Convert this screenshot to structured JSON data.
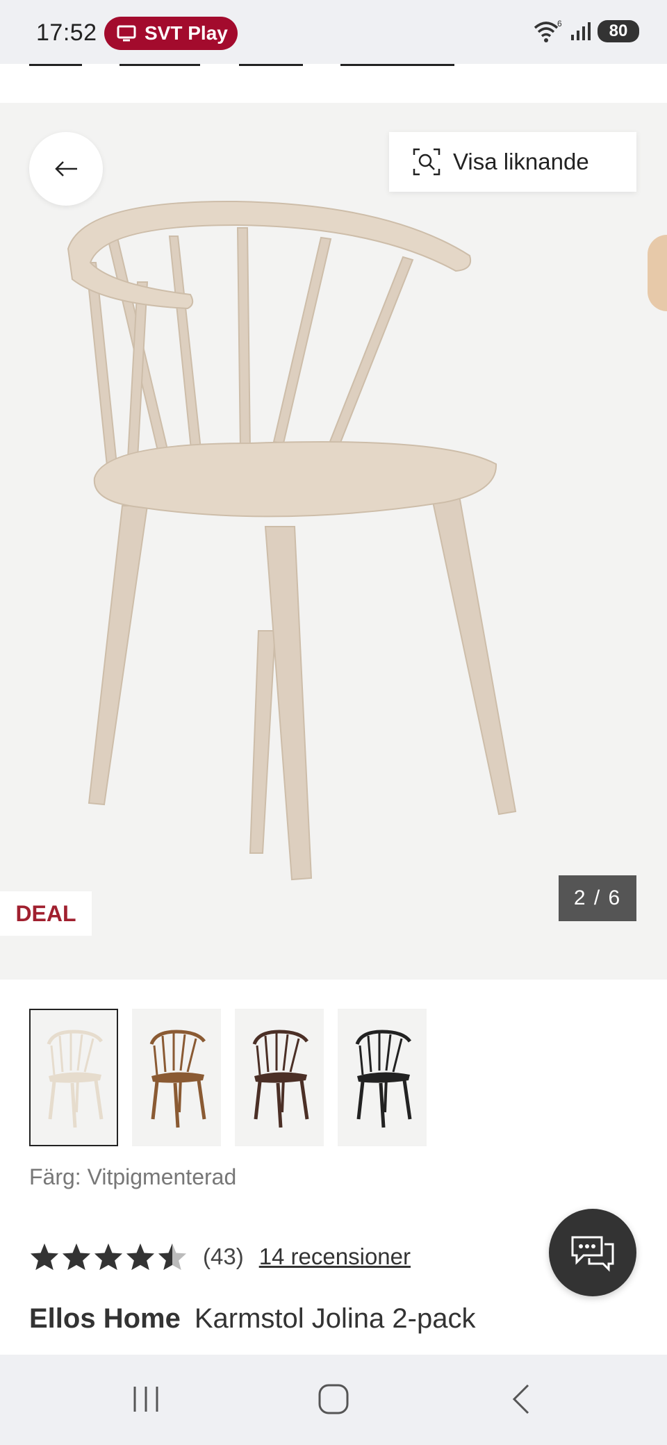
{
  "status_bar": {
    "time": "17:52",
    "notification_pill": "SVT Play",
    "pill_color": "#a30b2d",
    "battery": "80",
    "wifi_badge": "6"
  },
  "hero": {
    "similar_button_label": "Visa liknande",
    "deal_badge": "DEAL",
    "deal_color": "#a0202f",
    "image_counter": "2 / 6",
    "background": "#f3f3f2"
  },
  "variants": [
    {
      "name": "vitpigmenterad",
      "color": "#e6dccd",
      "selected": true
    },
    {
      "name": "brown",
      "color": "#8a5a33",
      "selected": false
    },
    {
      "name": "dark-brown",
      "color": "#4b2f26",
      "selected": false
    },
    {
      "name": "black",
      "color": "#222222",
      "selected": false
    }
  ],
  "color_label": "Färg: Vitpigmenterad",
  "rating": {
    "value": 4.5,
    "max": 5,
    "count": "(43)",
    "reviews_link": "14 recensioner"
  },
  "product": {
    "brand": "Ellos Home",
    "name": "Karmstol Jolina 2-pack"
  },
  "icons": {
    "back": "arrow-left-icon",
    "similar": "visual-search-icon",
    "chat": "chat-bubbles-icon",
    "nav_recents": "recents-icon",
    "nav_home": "home-icon",
    "nav_back": "back-chevron-icon"
  }
}
